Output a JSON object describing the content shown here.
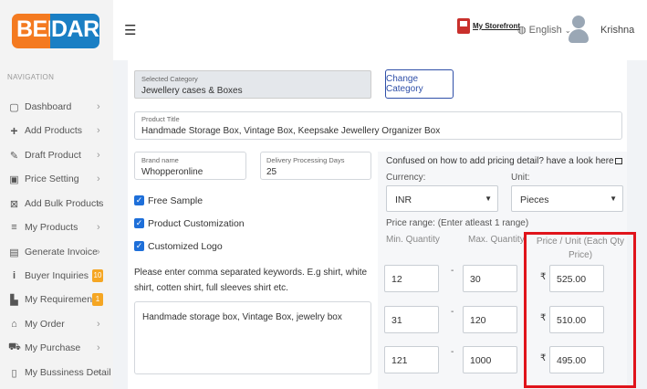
{
  "brand": {
    "logo_left": "BEL",
    "logo_right": "DARA"
  },
  "header": {
    "menu_icon": "hamburger-icon",
    "storefront_label": "My Storefront",
    "language": "English",
    "username": "Krishna"
  },
  "sidebar": {
    "title": "NAVIGATION",
    "items": [
      {
        "label": "Dashboard",
        "icon": "monitor-icon",
        "badge": ""
      },
      {
        "label": "Add Products",
        "icon": "plus-icon",
        "badge": ""
      },
      {
        "label": "Draft Product",
        "icon": "edit-icon",
        "badge": ""
      },
      {
        "label": "Price Setting",
        "icon": "money-icon",
        "badge": ""
      },
      {
        "label": "Add Bulk Products",
        "icon": "excel-icon",
        "badge": ""
      },
      {
        "label": "My Products",
        "icon": "list-icon",
        "badge": ""
      },
      {
        "label": "Generate Invoice",
        "icon": "invoice-icon",
        "badge": ""
      },
      {
        "label": "Buyer Inquiries",
        "icon": "info-icon",
        "badge": "10"
      },
      {
        "label": "My Requirements",
        "icon": "file-icon",
        "badge": "1"
      },
      {
        "label": "My Order",
        "icon": "basket-icon",
        "badge": ""
      },
      {
        "label": "My Purchase",
        "icon": "cart-icon",
        "badge": ""
      },
      {
        "label": "My Bussiness Detail",
        "icon": "building-icon",
        "badge": ""
      }
    ]
  },
  "form": {
    "selected_category_label": "Selected Category",
    "selected_category_value": "Jewellery cases & Boxes",
    "change_category_button": "Change Category",
    "product_title_label": "Product Title",
    "product_title_value": "Handmade Storage Box, Vintage Box, Keepsake Jewellery Organizer Box",
    "brand_name_label": "Brand name",
    "brand_name_value": "Whopperonline",
    "delivery_days_label": "Delivery Processing Days",
    "delivery_days_value": "25",
    "free_sample_label": "Free Sample",
    "customization_label": "Product Customization",
    "custom_logo_label": "Customized Logo",
    "free_sample_checked": true,
    "customization_checked": true,
    "custom_logo_checked": true,
    "keywords_help": "Please enter comma separated keywords. E.g shirt, white shirt, cotten shirt, full sleeves shirt etc.",
    "keywords_value": "Handmade storage box, Vintage Box, jewelry box"
  },
  "pricing": {
    "help_text": "Confused on how to add pricing detail? have a look here",
    "currency_label": "Currency:",
    "currency_value": "INR",
    "unit_label": "Unit:",
    "unit_value": "Pieces",
    "range_label": "Price range: (Enter atleast 1 range)",
    "min_qty_header": "Min. Quantity",
    "max_qty_header": "Max. Quantity",
    "price_header": "Price / Unit (Each Qty Price)",
    "currency_symbol": "₹",
    "rows": [
      {
        "min": "12",
        "max": "30",
        "price": "525.00"
      },
      {
        "min": "31",
        "max": "120",
        "price": "510.00"
      },
      {
        "min": "121",
        "max": "1000",
        "price": "495.00"
      }
    ]
  },
  "colors": {
    "logo_orange": "#f47a20",
    "logo_blue": "#1a7fc4",
    "accent_blue": "#2f4fa8",
    "checkbox_blue": "#1e6fd9",
    "badge_orange": "#f5a623",
    "highlight_red": "#e0141b"
  }
}
